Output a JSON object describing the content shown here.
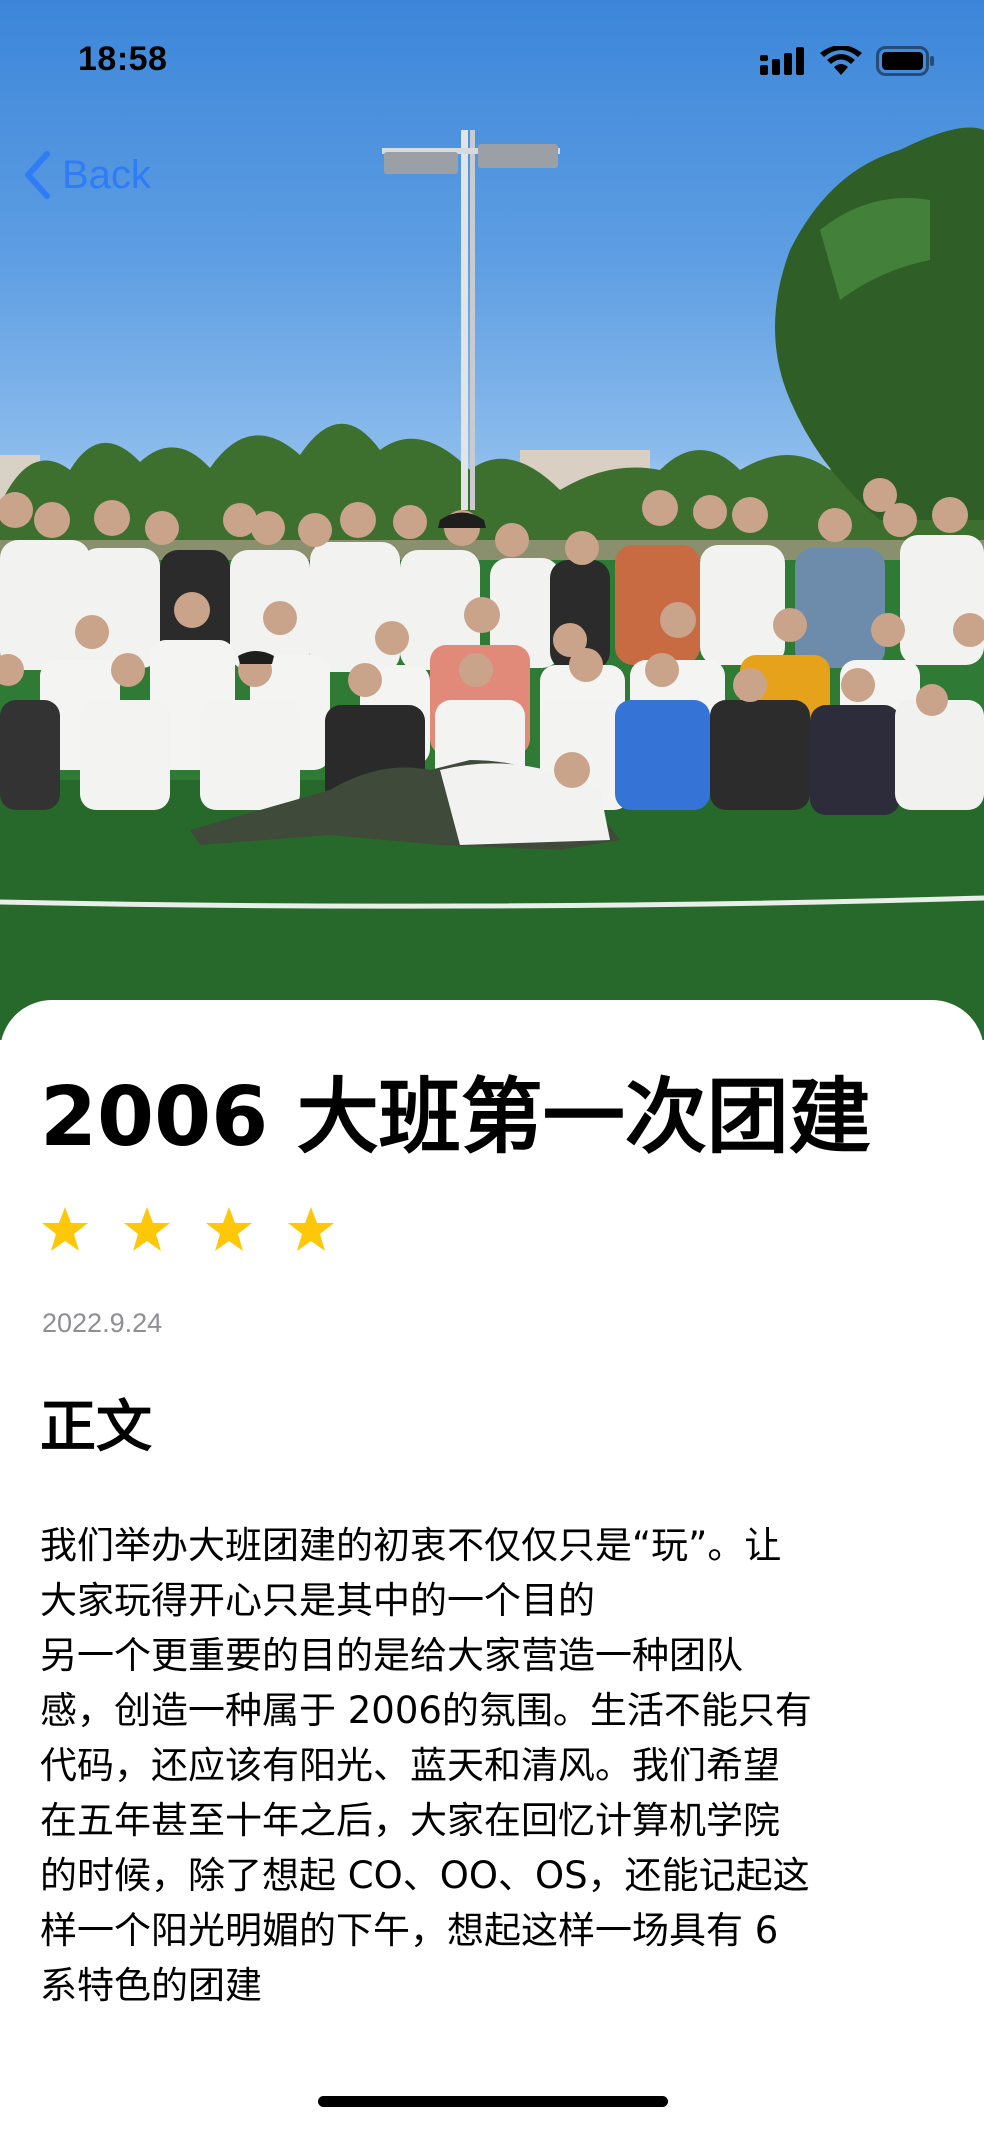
{
  "status_bar": {
    "time": "18:58",
    "icons": [
      "cellular-signal-icon",
      "wifi-icon",
      "battery-icon"
    ]
  },
  "nav": {
    "back_label": "Back",
    "back_icon": "chevron-left-icon",
    "accent_color": "#2f7cf6"
  },
  "hero": {
    "image_kind": "group-photo",
    "description_icon": "photo-icon"
  },
  "post": {
    "title": "2006 大班第一次团建",
    "rating": 4,
    "rating_color": "#ffc70a",
    "date": "2022.9.24",
    "section_heading": "正文",
    "body": "我们举办大班团建的初衷不仅仅只是“玩”。让\n大家玩得开心只是其中的一个目的\n另一个更重要的目的是给大家营造一种团队\n感，创造一种属于 2006的氛围。生活不能只有\n代码，还应该有阳光、蓝天和清风。我们希望\n在五年甚至十年之后，大家在回忆计算机学院\n的时候，除了想起 CO、OO、OS，还能记起这\n样一个阳光明媚的下午，想起这样一场具有 6\n系特色的团建"
  }
}
